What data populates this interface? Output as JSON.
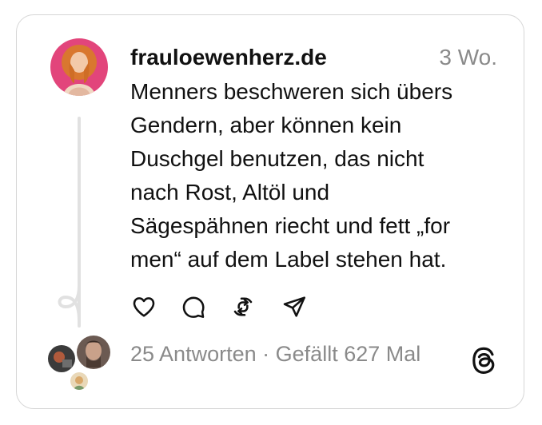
{
  "post": {
    "username": "frauloewenherz.de",
    "timestamp": "3 Wo.",
    "text_lines": [
      "Menners beschweren sich übers",
      "Gendern, aber können kein",
      "Duschgel benutzen, das nicht",
      "nach Rost, Altöl und",
      "Sägespähnen riecht und fett „for",
      "men“ auf dem Label stehen hat."
    ],
    "replies_label": "25 Antworten",
    "separator": "·",
    "likes_label": "Gefällt 627 Mal"
  },
  "actions": [
    {
      "name": "like-button",
      "icon": "heart-icon"
    },
    {
      "name": "reply-button",
      "icon": "comment-icon"
    },
    {
      "name": "repost-button",
      "icon": "repost-icon"
    },
    {
      "name": "share-button",
      "icon": "send-icon"
    }
  ],
  "colors": {
    "text": "#111111",
    "muted": "#8a8a8a",
    "border": "#d6d6d6",
    "thread_line": "#e1e1e1"
  }
}
